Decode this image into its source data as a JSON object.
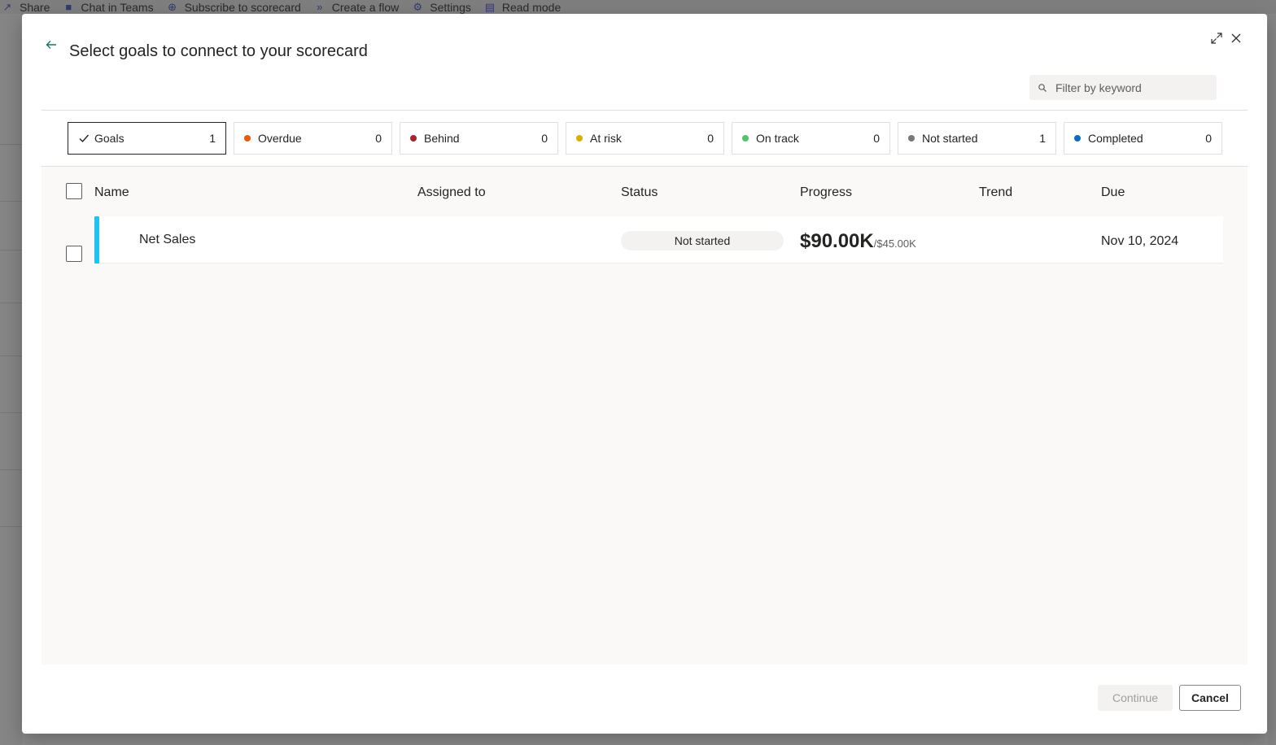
{
  "background": {
    "toolbar": [
      {
        "icon": "share-icon",
        "label": "Share"
      },
      {
        "icon": "teams-icon",
        "label": "Chat in Teams"
      },
      {
        "icon": "subscribe-icon",
        "label": "Subscribe to scorecard"
      },
      {
        "icon": "flow-icon",
        "label": "Create a flow"
      },
      {
        "icon": "gear-icon",
        "label": "Settings"
      },
      {
        "icon": "read-mode-icon",
        "label": "Read mode"
      }
    ]
  },
  "dialog": {
    "title": "Select goals to connect to your scorecard",
    "search": {
      "placeholder": "Filter by keyword"
    },
    "filters": [
      {
        "label": "Goals",
        "count": "1",
        "active": true,
        "color": ""
      },
      {
        "label": "Overdue",
        "count": "0",
        "color": "#e8590c"
      },
      {
        "label": "Behind",
        "count": "0",
        "color": "#a4262c"
      },
      {
        "label": "At risk",
        "count": "0",
        "color": "#d8b200"
      },
      {
        "label": "On track",
        "count": "0",
        "color": "#4fc66a"
      },
      {
        "label": "Not started",
        "count": "1",
        "color": "#797775"
      },
      {
        "label": "Completed",
        "count": "0",
        "color": "#0f6cbd"
      }
    ],
    "table": {
      "columns": {
        "name": "Name",
        "assigned": "Assigned to",
        "status": "Status",
        "progress": "Progress",
        "trend": "Trend",
        "due": "Due"
      },
      "rows": [
        {
          "name": "Net Sales",
          "status": "Not started",
          "progress_value": "$90.00K",
          "progress_target": "/$45.00K",
          "due": "Nov 10, 2024",
          "accent_color": "#1fc2f0"
        }
      ]
    },
    "buttons": {
      "continue": "Continue",
      "cancel": "Cancel"
    }
  }
}
